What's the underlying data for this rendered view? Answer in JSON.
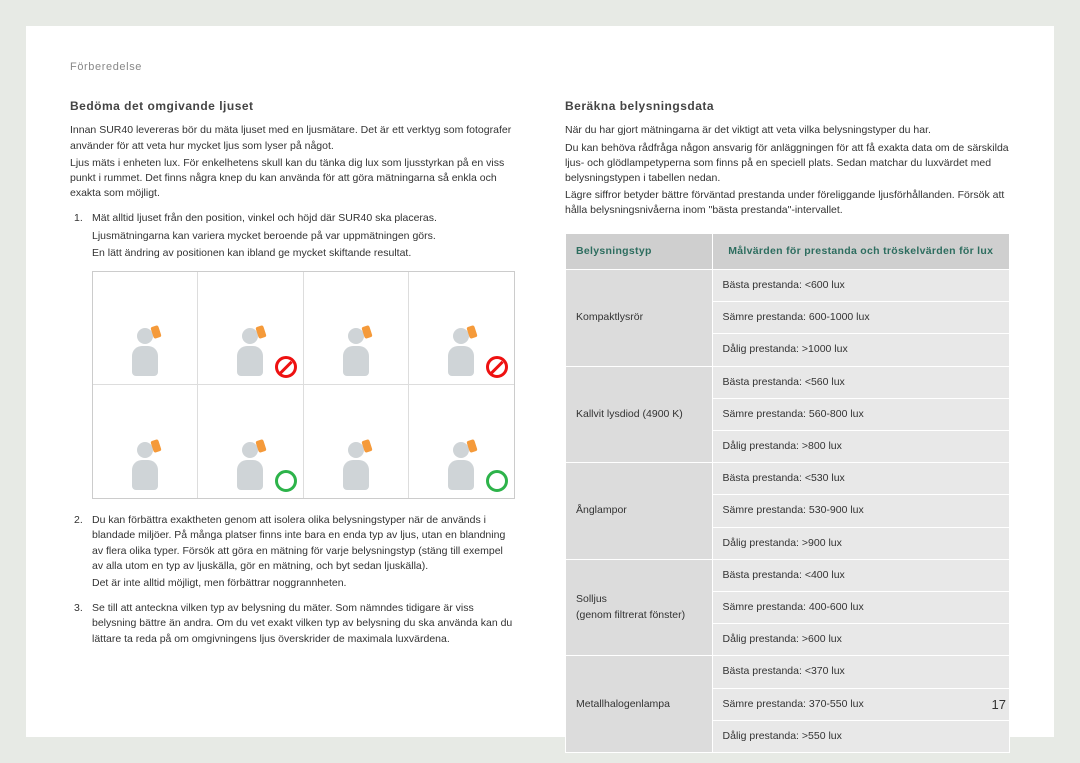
{
  "section_label": "Förberedelse",
  "page_number": "17",
  "left": {
    "heading": "Bedöma det omgivande ljuset",
    "intro": [
      "Innan SUR40 levereras bör du mäta ljuset med en ljusmätare. Det är ett verktyg som fotografer använder för att veta hur mycket ljus som lyser på något.",
      "Ljus mäts i enheten lux. För enkelhetens skull kan du tänka dig lux som ljusstyrkan på en viss punkt i rummet. Det finns några knep du kan använda för att göra mätningarna så enkla och exakta som möjligt."
    ],
    "item1": [
      "Mät alltid ljuset från den position, vinkel och höjd där SUR40 ska placeras.",
      "Ljusmätningarna kan variera mycket beroende på var uppmätningen görs.",
      "En lätt ändring av positionen kan ibland ge mycket skiftande resultat."
    ],
    "item2": [
      "Du kan förbättra exaktheten genom att isolera olika belysningstyper när de används i blandade miljöer. På många platser finns inte bara en enda typ av ljus, utan en blandning av flera olika typer. Försök att göra en mätning för varje belysningstyp (stäng till exempel av alla utom en typ av ljuskälla, gör en mätning, och byt sedan ljuskälla).",
      "Det är inte alltid möjligt, men förbättrar noggrannheten."
    ],
    "item3": "Se till att anteckna vilken typ av belysning du mäter. Som nämndes tidigare är viss belysning bättre än andra. Om du vet exakt vilken typ av belysning du ska använda kan du lättare ta reda på om omgivningens ljus överskrider de maximala luxvärdena."
  },
  "right": {
    "heading": "Beräkna belysningsdata",
    "intro": [
      "När du har gjort mätningarna är det viktigt att veta vilka belysningstyper du har.",
      "Du kan behöva rådfråga någon ansvarig för anläggningen för att få exakta data om de särskilda ljus- och glödlampetyperna som finns på en speciell plats. Sedan matchar du luxvärdet med belysningstypen i tabellen nedan.",
      "Lägre siffror betyder bättre förväntad prestanda under föreliggande ljusförhållanden. Försök att hålla belysningsnivåerna inom \"bästa prestanda\"-intervallet."
    ],
    "table": {
      "col1": "Belysningstyp",
      "col2": "Målvärden för prestanda och tröskelvärden för lux",
      "rows": [
        {
          "type": "Kompaktlysrör",
          "vals": [
            "Bästa prestanda: <600 lux",
            "Sämre prestanda: 600-1000 lux",
            "Dålig prestanda: >1000 lux"
          ]
        },
        {
          "type": "Kallvit lysdiod (4900 K)",
          "vals": [
            "Bästa prestanda: <560 lux",
            "Sämre prestanda: 560-800 lux",
            "Dålig prestanda: >800 lux"
          ]
        },
        {
          "type": "Ånglampor",
          "vals": [
            "Bästa prestanda: <530 lux",
            "Sämre prestanda: 530-900 lux",
            "Dålig prestanda: >900 lux"
          ]
        },
        {
          "type": "Solljus\n(genom filtrerat fönster)",
          "vals": [
            "Bästa prestanda: <400 lux",
            "Sämre prestanda: 400-600 lux",
            "Dålig prestanda: >600 lux"
          ]
        },
        {
          "type": "Metallhalogenlampa",
          "vals": [
            "Bästa prestanda: <370 lux",
            "Sämre prestanda: 370-550 lux",
            "Dålig prestanda: >550 lux"
          ]
        }
      ]
    }
  }
}
